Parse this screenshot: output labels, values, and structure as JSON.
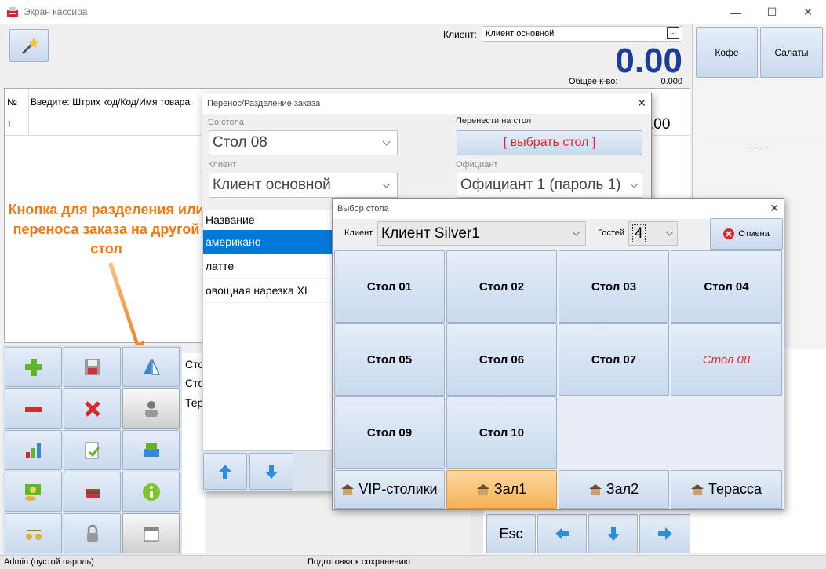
{
  "window": {
    "title": "Экран кассира",
    "min": "—",
    "max": "☐",
    "close": "✕"
  },
  "client": {
    "label": "Клиент:",
    "value": "Клиент основной",
    "browse": "..."
  },
  "total": {
    "amount": "0.00",
    "qty_label": "Общее к-во:",
    "qty_value": "0.000"
  },
  "order_table": {
    "col_num": "№",
    "col_input": "Введите: Штрих код/Код/Имя товара",
    "row_num": "1",
    "row_sum_fragment": ".00"
  },
  "categories": [
    {
      "label": "Кофе"
    },
    {
      "label": "Салаты"
    }
  ],
  "category_dots": "·········",
  "annotation": {
    "text": "Кнопка для разделения или переноса  заказа на другой стол"
  },
  "left_tables_partial": [
    "Сто",
    "Сто",
    "Тер"
  ],
  "numpad": {
    "esc": "Esc"
  },
  "dialog_transfer": {
    "title": "Перенос/Разделение заказа",
    "from_label": "Со стола",
    "from_value": "Стол 08",
    "to_label": "Перенести на стол",
    "to_button": "[ выбрать стол ]",
    "client_label": "Клиент",
    "client_value": "Клиент основной",
    "waiter_label": "Официант",
    "waiter_value": "Официант 1 (пароль 1)",
    "list_header": "Название",
    "items": [
      "американо",
      "латте",
      "овощная нарезка XL"
    ]
  },
  "dialog_table": {
    "title": "Выбор стола",
    "client_label": "Клиент",
    "client_value": "Клиент Silver1",
    "guests_label": "Гостей",
    "guests_value": "4",
    "cancel": "Отмена",
    "tables": [
      "Стол 01",
      "Стол 02",
      "Стол 03",
      "Стол 04",
      "Стол 05",
      "Стол 06",
      "Стол 07",
      "Стол 08",
      "Стол 09",
      "Стол 10"
    ],
    "halls": [
      "VIP-столики",
      "Зал1",
      "Зал2",
      "Терасса"
    ]
  },
  "statusbar": {
    "user": "Admin (пустой пароль)",
    "status": "Подготовка к сохранению"
  },
  "colors": {
    "accent_blue": "#1a3f9a",
    "orange": "#f07a12",
    "red": "#e0262c",
    "selected_row": "#0078d7"
  }
}
